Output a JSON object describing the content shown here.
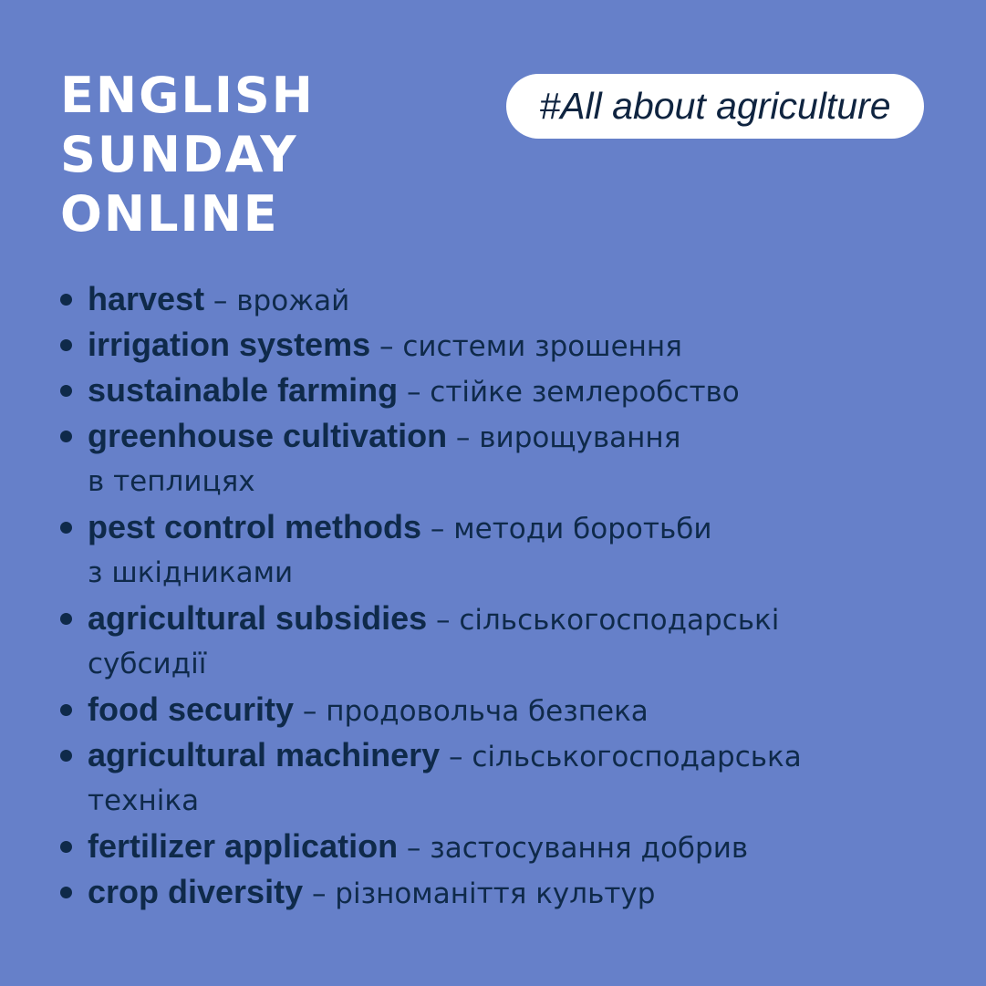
{
  "title_lines": [
    "English",
    "Sunday",
    "Online"
  ],
  "hashtag": "#All about agriculture",
  "terms": [
    {
      "en": "harvest",
      "ua": " – врожай",
      "ua2": ""
    },
    {
      "en": "irrigation systems",
      "ua": " – системи зрошення",
      "ua2": ""
    },
    {
      "en": "sustainable farming",
      "ua": " – стійке землеробство",
      "ua2": ""
    },
    {
      "en": "greenhouse cultivation",
      "ua": " – вирощування",
      "ua2": "в теплицях"
    },
    {
      "en": "pest control methods",
      "ua": " – методи боротьби",
      "ua2": "з шкідниками"
    },
    {
      "en": "agricultural subsidies",
      "ua": " – сільськогосподарські",
      "ua2": "субсидії"
    },
    {
      "en": "food security",
      "ua": " – продовольча безпека",
      "ua2": ""
    },
    {
      "en": "agricultural machinery",
      "ua": " – сільськогосподарська",
      "ua2": "техніка"
    },
    {
      "en": "fertilizer application",
      "ua": " – застосування добрив",
      "ua2": ""
    },
    {
      "en": "crop diversity",
      "ua": " – різноманіття культур",
      "ua2": ""
    }
  ],
  "colors": {
    "background": "#6680c9",
    "title": "#ffffff",
    "text": "#0f2a4a",
    "tag_background": "#ffffff"
  },
  "icons": {
    "bullet": "filled-circle"
  }
}
